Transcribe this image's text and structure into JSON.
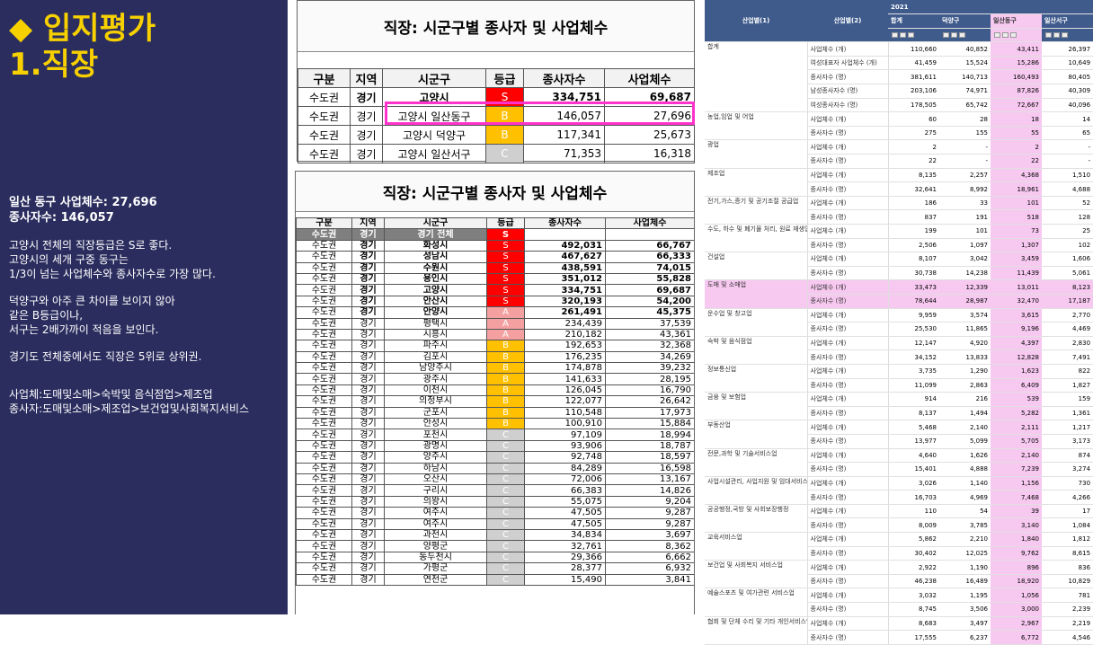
{
  "left": {
    "title1": "◆ 입지평가",
    "title2": "1.직장",
    "summary1": "일산 동구 사업체수: 27,696",
    "summary2": "종사자수: 146,057",
    "para1": "고양시 전체의 직장등급은 S로 좋다.\n고양시의 세개 구중 동구는\n1/3이 넘는 사업체수와 종사자수로 가장 많다.",
    "para2": "덕양구와 아주 큰 차이를 보이지 않아\n같은 B등급이나,\n서구는 2배가까이 적음을 보인다.",
    "para3": "경기도 전체중에서도 직장은 5위로 상위권.",
    "para4": "사업체:도매및소매>숙박및 음식점업>제조업\n종사자:도매및소매>제조업>보건업및사회복지서비스"
  },
  "table1": {
    "caption": "직장: 시군구별 종사자 및 사업체수",
    "headers": [
      "구분",
      "지역",
      "시군구",
      "등급",
      "종사자수",
      "사업체수"
    ],
    "rows": [
      [
        "수도권",
        "경기",
        "고양시",
        "S",
        "334,751",
        "69,687"
      ],
      [
        "수도권",
        "경기",
        "고양시 일산동구",
        "B",
        "146,057",
        "27,696"
      ],
      [
        "수도권",
        "경기",
        "고양시 덕양구",
        "B",
        "117,341",
        "25,673"
      ],
      [
        "수도권",
        "경기",
        "고양시 일산서구",
        "C",
        "71,353",
        "16,318"
      ]
    ]
  },
  "table2": {
    "caption": "직장: 시군구별 종사자 및 사업체수",
    "headers": [
      "구분",
      "지역",
      "시군구",
      "등급",
      "종사자수",
      "사업체수"
    ],
    "total": [
      "수도권",
      "경기",
      "경기 전체",
      "S",
      "",
      ""
    ],
    "rows": [
      [
        "수도권",
        "경기",
        "화성시",
        "S",
        "492,031",
        "66,767"
      ],
      [
        "수도권",
        "경기",
        "성남시",
        "S",
        "467,627",
        "66,333"
      ],
      [
        "수도권",
        "경기",
        "수원시",
        "S",
        "438,591",
        "74,015"
      ],
      [
        "수도권",
        "경기",
        "용인시",
        "S",
        "351,012",
        "55,828"
      ],
      [
        "수도권",
        "경기",
        "고양시",
        "S",
        "334,751",
        "69,687"
      ],
      [
        "수도권",
        "경기",
        "안산시",
        "S",
        "320,193",
        "54,200"
      ],
      [
        "수도권",
        "경기",
        "안양시",
        "A",
        "261,491",
        "45,375"
      ],
      [
        "수도권",
        "경기",
        "평택시",
        "A",
        "234,439",
        "37,539"
      ],
      [
        "수도권",
        "경기",
        "시흥시",
        "A",
        "210,182",
        "43,361"
      ],
      [
        "수도권",
        "경기",
        "파주시",
        "B",
        "192,653",
        "32,368"
      ],
      [
        "수도권",
        "경기",
        "김포시",
        "B",
        "176,235",
        "34,269"
      ],
      [
        "수도권",
        "경기",
        "남양주시",
        "B",
        "174,878",
        "39,232"
      ],
      [
        "수도권",
        "경기",
        "광주시",
        "B",
        "141,633",
        "28,195"
      ],
      [
        "수도권",
        "경기",
        "이천시",
        "B",
        "126,045",
        "16,790"
      ],
      [
        "수도권",
        "경기",
        "의정부시",
        "B",
        "122,077",
        "26,642"
      ],
      [
        "수도권",
        "경기",
        "군포시",
        "B",
        "110,548",
        "17,973"
      ],
      [
        "수도권",
        "경기",
        "안성시",
        "B",
        "100,910",
        "15,884"
      ],
      [
        "수도권",
        "경기",
        "포천시",
        "C",
        "97,109",
        "18,994"
      ],
      [
        "수도권",
        "경기",
        "광명시",
        "C",
        "93,906",
        "18,787"
      ],
      [
        "수도권",
        "경기",
        "양주시",
        "C",
        "92,748",
        "18,597"
      ],
      [
        "수도권",
        "경기",
        "하남시",
        "C",
        "84,289",
        "16,598"
      ],
      [
        "수도권",
        "경기",
        "오산시",
        "C",
        "72,006",
        "13,167"
      ],
      [
        "수도권",
        "경기",
        "구리시",
        "C",
        "66,383",
        "14,826"
      ],
      [
        "수도권",
        "경기",
        "의왕시",
        "C",
        "55,075",
        "9,204"
      ],
      [
        "수도권",
        "경기",
        "여주시",
        "C",
        "47,505",
        "9,287"
      ],
      [
        "수도권",
        "경기",
        "여주시",
        "C",
        "47,505",
        "9,287"
      ],
      [
        "수도권",
        "경기",
        "과천시",
        "C",
        "34,834",
        "3,697"
      ],
      [
        "수도권",
        "경기",
        "양평군",
        "C",
        "32,761",
        "8,362"
      ],
      [
        "수도권",
        "경기",
        "동두천시",
        "C",
        "29,366",
        "6,662"
      ],
      [
        "수도권",
        "경기",
        "가평군",
        "C",
        "28,377",
        "6,932"
      ],
      [
        "수도권",
        "경기",
        "연천군",
        "C",
        "15,490",
        "3,841"
      ]
    ]
  },
  "stats": {
    "year": "2021",
    "col1": "산업별(1)",
    "col2": "산업별(2)",
    "subcols": [
      "합계",
      "덕양구",
      "일산동구",
      "일산서구"
    ],
    "groups": [
      {
        "name": "합계",
        "rows": [
          [
            "사업체수 (개)",
            "110,660",
            "40,852",
            "43,411",
            "26,397"
          ],
          [
            "여성대표자 사업체수 (개)",
            "41,459",
            "15,524",
            "15,286",
            "10,649"
          ],
          [
            "종사자수 (명)",
            "381,611",
            "140,713",
            "160,493",
            "80,405"
          ],
          [
            "남성종사자수 (명)",
            "203,106",
            "74,971",
            "87,826",
            "40,309"
          ],
          [
            "여성종사자수 (명)",
            "178,505",
            "65,742",
            "72,667",
            "40,096"
          ]
        ]
      },
      {
        "name": "농업,임업 및 어업",
        "rows": [
          [
            "사업체수 (개)",
            "60",
            "28",
            "18",
            "14"
          ],
          [
            "종사자수 (명)",
            "275",
            "155",
            "55",
            "65"
          ]
        ]
      },
      {
        "name": "광업",
        "rows": [
          [
            "사업체수 (개)",
            "2",
            "-",
            "2",
            "-"
          ],
          [
            "종사자수 (명)",
            "22",
            "-",
            "22",
            "-"
          ]
        ]
      },
      {
        "name": "제조업",
        "rows": [
          [
            "사업체수 (개)",
            "8,135",
            "2,257",
            "4,368",
            "1,510"
          ],
          [
            "종사자수 (명)",
            "32,641",
            "8,992",
            "18,961",
            "4,688"
          ]
        ]
      },
      {
        "name": "전기,가스,증기 및 공기조절 공급업",
        "rows": [
          [
            "사업체수 (개)",
            "186",
            "33",
            "101",
            "52"
          ],
          [
            "종사자수 (명)",
            "837",
            "191",
            "518",
            "128"
          ]
        ]
      },
      {
        "name": "수도, 하수 및 폐기물 처리, 원료 재생업",
        "rows": [
          [
            "사업체수 (개)",
            "199",
            "101",
            "73",
            "25"
          ],
          [
            "종사자수 (명)",
            "2,506",
            "1,097",
            "1,307",
            "102"
          ]
        ]
      },
      {
        "name": "건설업",
        "rows": [
          [
            "사업체수 (개)",
            "8,107",
            "3,042",
            "3,459",
            "1,606"
          ],
          [
            "종사자수 (명)",
            "30,738",
            "14,238",
            "11,439",
            "5,061"
          ]
        ]
      },
      {
        "name": "도매 및 소매업",
        "highlight": true,
        "rows": [
          [
            "사업체수 (개)",
            "33,473",
            "12,339",
            "13,011",
            "8,123"
          ],
          [
            "종사자수 (명)",
            "78,644",
            "28,987",
            "32,470",
            "17,187"
          ]
        ]
      },
      {
        "name": "운수업 및 창고업",
        "rows": [
          [
            "사업체수 (개)",
            "9,959",
            "3,574",
            "3,615",
            "2,770"
          ],
          [
            "종사자수 (명)",
            "25,530",
            "11,865",
            "9,196",
            "4,469"
          ]
        ]
      },
      {
        "name": "숙박 및 음식점업",
        "rows": [
          [
            "사업체수 (개)",
            "12,147",
            "4,920",
            "4,397",
            "2,830"
          ],
          [
            "종사자수 (명)",
            "34,152",
            "13,833",
            "12,828",
            "7,491"
          ]
        ]
      },
      {
        "name": "정보통신업",
        "rows": [
          [
            "사업체수 (개)",
            "3,735",
            "1,290",
            "1,623",
            "822"
          ],
          [
            "종사자수 (명)",
            "11,099",
            "2,863",
            "6,409",
            "1,827"
          ]
        ]
      },
      {
        "name": "금융 및 보험업",
        "rows": [
          [
            "사업체수 (개)",
            "914",
            "216",
            "539",
            "159"
          ],
          [
            "종사자수 (명)",
            "8,137",
            "1,494",
            "5,282",
            "1,361"
          ]
        ]
      },
      {
        "name": "부동산업",
        "rows": [
          [
            "사업체수 (개)",
            "5,468",
            "2,140",
            "2,111",
            "1,217"
          ],
          [
            "종사자수 (명)",
            "13,977",
            "5,099",
            "5,705",
            "3,173"
          ]
        ]
      },
      {
        "name": "전문,과학 및 기술서비스업",
        "rows": [
          [
            "사업체수 (개)",
            "4,640",
            "1,626",
            "2,140",
            "874"
          ],
          [
            "종사자수 (명)",
            "15,401",
            "4,888",
            "7,239",
            "3,274"
          ]
        ]
      },
      {
        "name": "사업시설관리, 사업지원 및 임대서비스업",
        "rows": [
          [
            "사업체수 (개)",
            "3,026",
            "1,140",
            "1,156",
            "730"
          ],
          [
            "종사자수 (명)",
            "16,703",
            "4,969",
            "7,468",
            "4,266"
          ]
        ]
      },
      {
        "name": "공공행정,국방 및 사회보장행정",
        "rows": [
          [
            "사업체수 (개)",
            "110",
            "54",
            "39",
            "17"
          ],
          [
            "종사자수 (명)",
            "8,009",
            "3,785",
            "3,140",
            "1,084"
          ]
        ]
      },
      {
        "name": "교육서비스업",
        "rows": [
          [
            "사업체수 (개)",
            "5,862",
            "2,210",
            "1,840",
            "1,812"
          ],
          [
            "종사자수 (명)",
            "30,402",
            "12,025",
            "9,762",
            "8,615"
          ]
        ]
      },
      {
        "name": "보건업 및 사회복지 서비스업",
        "rows": [
          [
            "사업체수 (개)",
            "2,922",
            "1,190",
            "896",
            "836"
          ],
          [
            "종사자수 (명)",
            "46,238",
            "16,489",
            "18,920",
            "10,829"
          ]
        ]
      },
      {
        "name": "예술스포츠 및 여가관련 서비스업",
        "rows": [
          [
            "사업체수 (개)",
            "3,032",
            "1,195",
            "1,056",
            "781"
          ],
          [
            "종사자수 (명)",
            "8,745",
            "3,506",
            "3,000",
            "2,239"
          ]
        ]
      },
      {
        "name": "협회 및 단체 수리 및 기타 개인서비스업",
        "rows": [
          [
            "사업체수 (개)",
            "8,683",
            "3,497",
            "2,967",
            "2,219"
          ],
          [
            "종사자수 (명)",
            "17,555",
            "6,237",
            "6,772",
            "4,546"
          ]
        ]
      }
    ]
  }
}
